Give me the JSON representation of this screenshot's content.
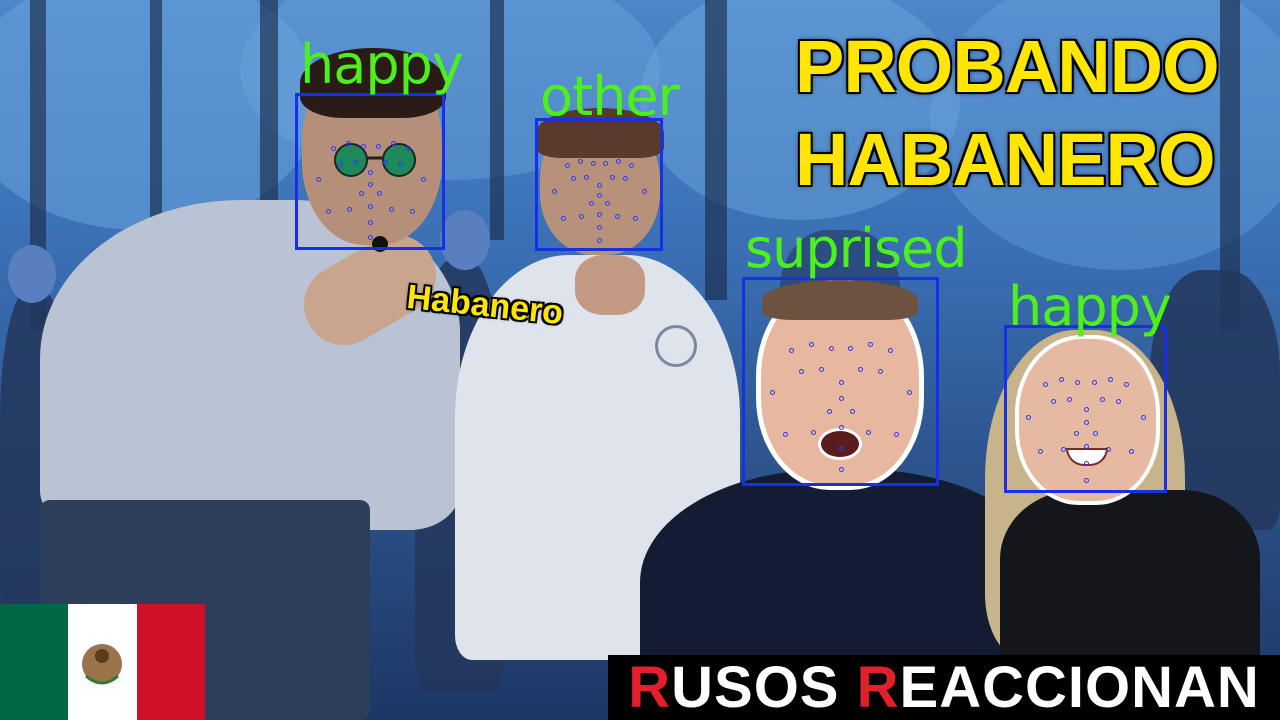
{
  "title": {
    "line1": "PROBANDO",
    "line2": "HABANERO"
  },
  "sign_label": "Habanero",
  "caption": {
    "word1_initial": "R",
    "word1_rest": "USOS ",
    "word2_initial": "R",
    "word2_rest": "EACCIONAN"
  },
  "detections": [
    {
      "label": "happy"
    },
    {
      "label": "other"
    },
    {
      "label": "suprised"
    },
    {
      "label": "happy"
    }
  ],
  "colors": {
    "title_yellow": "#ffe600",
    "emotion_green": "#4cf01c",
    "face_box_blue": "#1730e6",
    "caption_red": "#e3202a",
    "flag_green": "#006847",
    "flag_red": "#ce1126"
  }
}
